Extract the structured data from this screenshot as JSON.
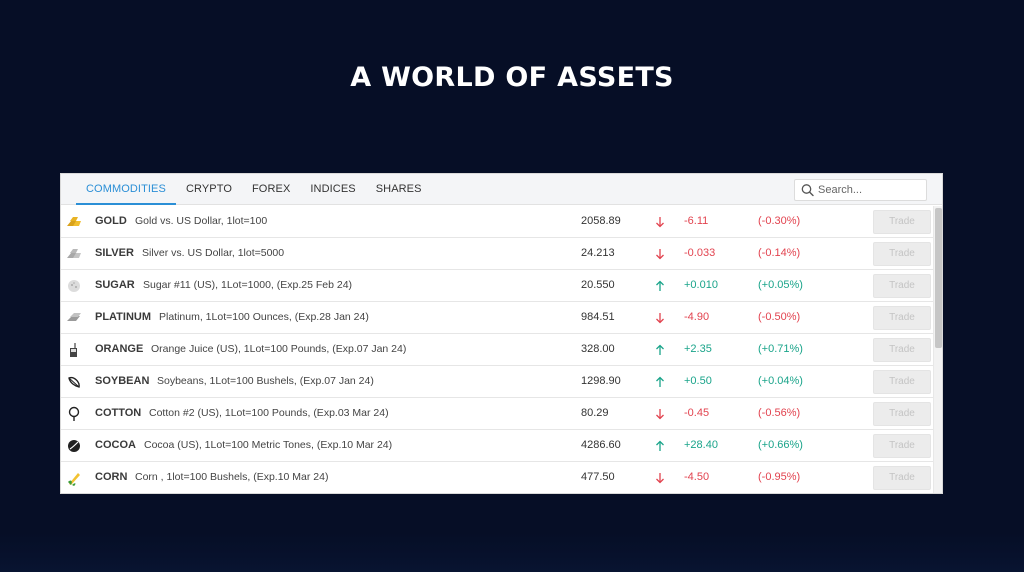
{
  "hero": {
    "title": "A WORLD OF ASSETS"
  },
  "tabs": [
    {
      "label": "COMMODITIES",
      "active": true
    },
    {
      "label": "CRYPTO",
      "active": false
    },
    {
      "label": "FOREX",
      "active": false
    },
    {
      "label": "INDICES",
      "active": false
    },
    {
      "label": "SHARES",
      "active": false
    }
  ],
  "search": {
    "placeholder": "Search..."
  },
  "trade_label": "Trade",
  "colors": {
    "up": "#1aa48a",
    "down": "#e2434f",
    "active_tab": "#2b8fd6",
    "background": "#060e26"
  },
  "assets": [
    {
      "symbol": "GOLD",
      "description": "Gold vs. US Dollar, 1lot=100",
      "price": "2058.89",
      "direction": "down",
      "change": "-6.11",
      "percent": "(-0.30%)",
      "icon": "gold-bars-icon"
    },
    {
      "symbol": "SILVER",
      "description": "Silver vs. US Dollar, 1lot=5000",
      "price": "24.213",
      "direction": "down",
      "change": "-0.033",
      "percent": "(-0.14%)",
      "icon": "silver-bars-icon"
    },
    {
      "symbol": "SUGAR",
      "description": "Sugar #11 (US), 1Lot=1000, (Exp.25 Feb 24)",
      "price": "20.550",
      "direction": "up",
      "change": "+0.010",
      "percent": "(+0.05%)",
      "icon": "sugar-icon"
    },
    {
      "symbol": "PLATINUM",
      "description": "Platinum, 1Lot=100 Ounces, (Exp.28 Jan 24)",
      "price": "984.51",
      "direction": "down",
      "change": "-4.90",
      "percent": "(-0.50%)",
      "icon": "platinum-bars-icon"
    },
    {
      "symbol": "ORANGE",
      "description": "Orange Juice (US), 1Lot=100 Pounds, (Exp.07 Jan 24)",
      "price": "328.00",
      "direction": "up",
      "change": "+2.35",
      "percent": "(+0.71%)",
      "icon": "juice-glass-icon"
    },
    {
      "symbol": "SOYBEAN",
      "description": "Soybeans, 1Lot=100 Bushels, (Exp.07 Jan 24)",
      "price": "1298.90",
      "direction": "up",
      "change": "+0.50",
      "percent": "(+0.04%)",
      "icon": "soybean-icon"
    },
    {
      "symbol": "COTTON",
      "description": "Cotton #2 (US), 1Lot=100 Pounds, (Exp.03 Mar 24)",
      "price": "80.29",
      "direction": "down",
      "change": "-0.45",
      "percent": "(-0.56%)",
      "icon": "cotton-icon"
    },
    {
      "symbol": "COCOA",
      "description": "Cocoa (US), 1Lot=100 Metric Tones, (Exp.10 Mar 24)",
      "price": "4286.60",
      "direction": "up",
      "change": "+28.40",
      "percent": "(+0.66%)",
      "icon": "cocoa-bean-icon"
    },
    {
      "symbol": "CORN",
      "description": "Corn , 1lot=100 Bushels, (Exp.10 Mar 24)",
      "price": "477.50",
      "direction": "down",
      "change": "-4.50",
      "percent": "(-0.95%)",
      "icon": "corn-icon"
    }
  ]
}
